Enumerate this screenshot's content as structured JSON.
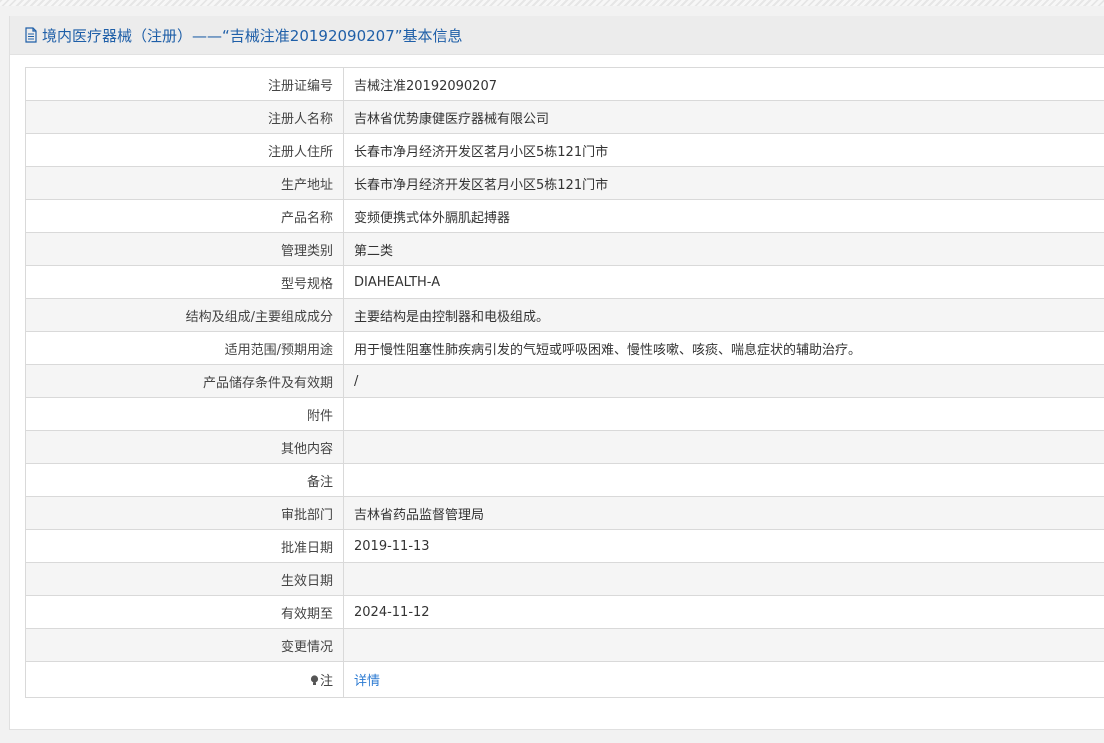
{
  "header": {
    "title": "境内医疗器械（注册）——“吉械注准20192090207”基本信息",
    "icon": "document-icon"
  },
  "rows": [
    {
      "label": "注册证编号",
      "value": "吉械注准20192090207"
    },
    {
      "label": "注册人名称",
      "value": "吉林省优势康健医疗器械有限公司"
    },
    {
      "label": "注册人住所",
      "value": "长春市净月经济开发区茗月小区5栋121门市"
    },
    {
      "label": "生产地址",
      "value": "长春市净月经济开发区茗月小区5栋121门市"
    },
    {
      "label": "产品名称",
      "value": "变频便携式体外膈肌起搏器"
    },
    {
      "label": "管理类别",
      "value": "第二类"
    },
    {
      "label": "型号规格",
      "value": "DIAHEALTH-A"
    },
    {
      "label": "结构及组成/主要组成成分",
      "value": "主要结构是由控制器和电极组成。"
    },
    {
      "label": "适用范围/预期用途",
      "value": "用于慢性阻塞性肺疾病引发的气短或呼吸困难、慢性咳嗽、咳痰、喘息症状的辅助治疗。"
    },
    {
      "label": "产品储存条件及有效期",
      "value": "/"
    },
    {
      "label": "附件",
      "value": ""
    },
    {
      "label": "其他内容",
      "value": ""
    },
    {
      "label": "备注",
      "value": ""
    },
    {
      "label": "审批部门",
      "value": "吉林省药品监督管理局"
    },
    {
      "label": "批准日期",
      "value": "2019-11-13"
    },
    {
      "label": "生效日期",
      "value": ""
    },
    {
      "label": "有效期至",
      "value": "2024-11-12"
    },
    {
      "label": "变更情况",
      "value": ""
    }
  ],
  "note": {
    "label": "注",
    "icon": "lightbulb-icon",
    "link_text": "详情"
  },
  "colors": {
    "header_text": "#1f5fa8",
    "link": "#2d7bd2",
    "alt_row": "#f5f5f5"
  }
}
